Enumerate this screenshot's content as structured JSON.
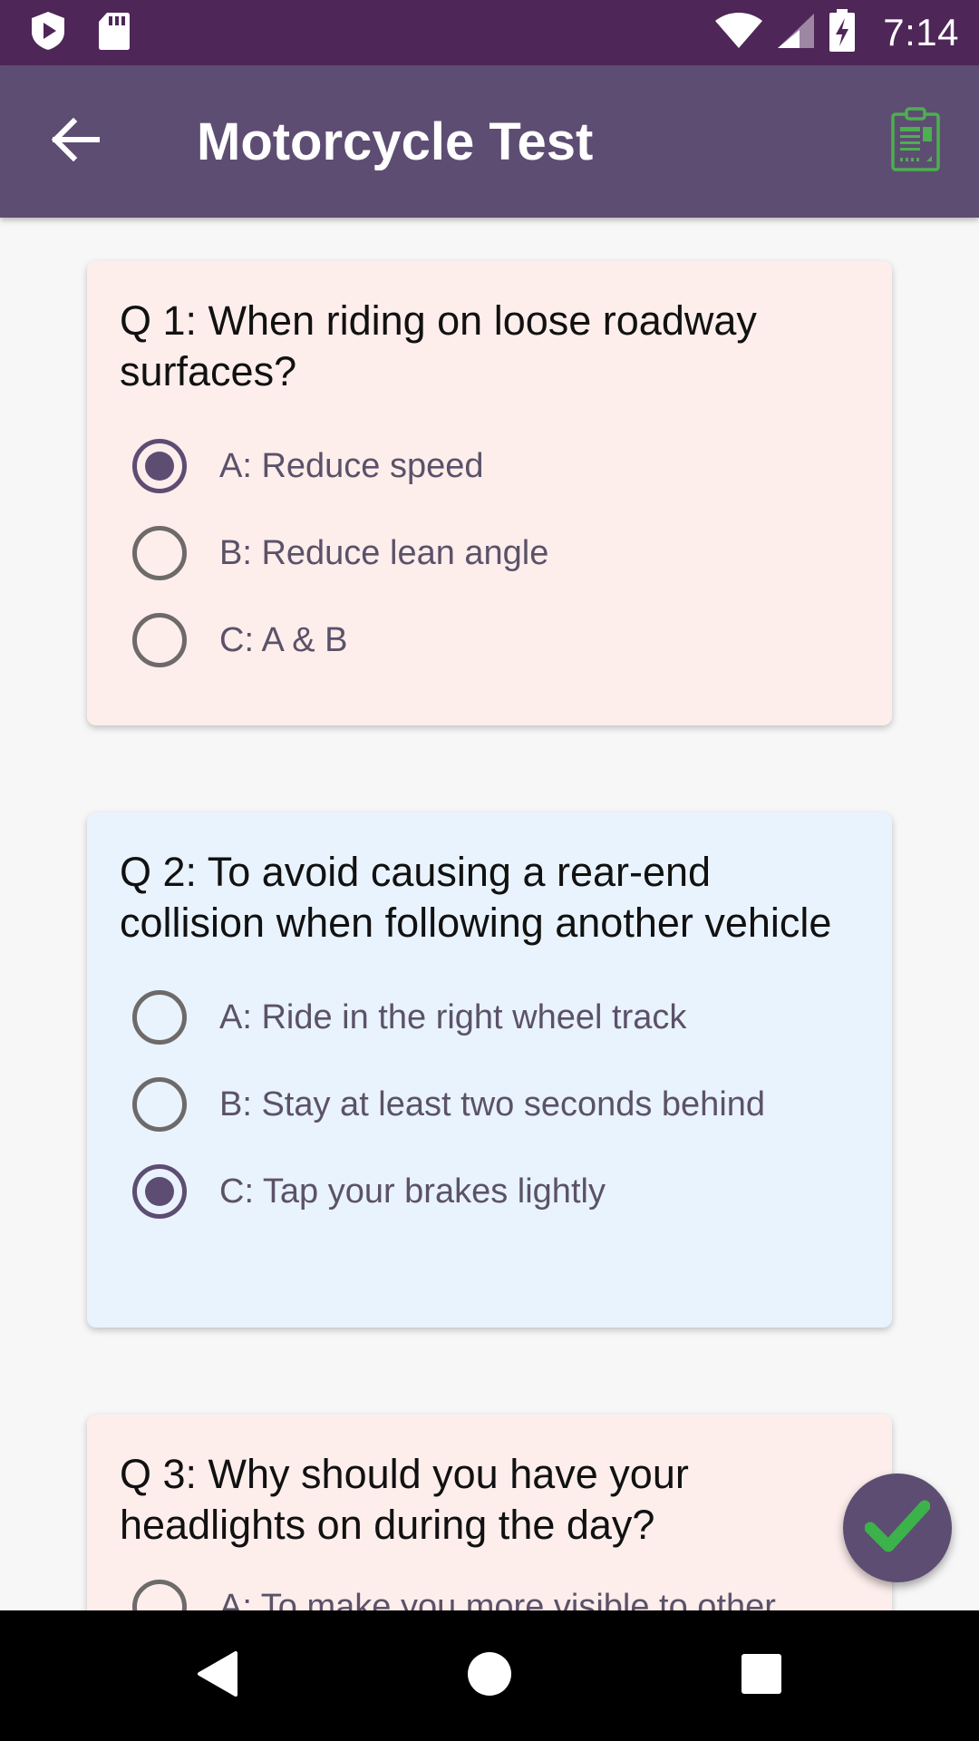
{
  "status_bar": {
    "time": "7:14",
    "icons": [
      "play-shield-icon",
      "sd-card-icon",
      "wifi-icon",
      "signal-icon",
      "battery-charging-icon"
    ]
  },
  "app_bar": {
    "title": "Motorcycle Test",
    "back_icon": "arrow-back-icon",
    "report_icon": "clipboard-report-icon",
    "report_icon_color": "#4caf50"
  },
  "colors": {
    "status_bar": "#4e2658",
    "app_bar": "#5e4d72",
    "card_pink": "#fdeeec",
    "card_blue": "#e9f3fd",
    "accent": "#5e4d72",
    "check": "#3cb24a"
  },
  "questions": [
    {
      "text": "Q 1: When riding on loose roadway surfaces?",
      "options": [
        {
          "label": "A: Reduce speed",
          "selected": true
        },
        {
          "label": "B: Reduce lean angle",
          "selected": false
        },
        {
          "label": "C: A & B",
          "selected": false
        }
      ]
    },
    {
      "text": "Q 2: To avoid causing a rear-end collision when following another vehicle",
      "options": [
        {
          "label": "A: Ride in the right wheel track",
          "selected": false
        },
        {
          "label": "B: Stay at least two seconds behind",
          "selected": false
        },
        {
          "label": "C: Tap your brakes lightly",
          "selected": true
        }
      ]
    },
    {
      "text": "Q 3: Why should you have your headlights on during the day?",
      "options": [
        {
          "label": "A: To make you more visible to other",
          "selected": false
        }
      ]
    }
  ],
  "fab": {
    "icon": "checkmark-icon"
  },
  "nav_bar": {
    "icons": [
      "back-triangle-icon",
      "home-circle-icon",
      "recents-square-icon"
    ]
  }
}
